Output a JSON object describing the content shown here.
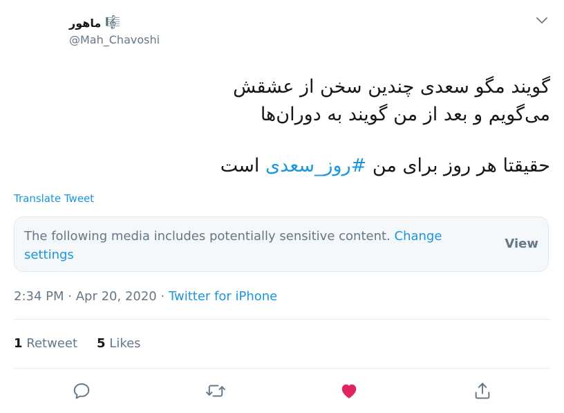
{
  "user": {
    "display_name": "ماهور",
    "name_emoji": "🎼",
    "handle": "@Mah_Chavoshi"
  },
  "tweet": {
    "line1": "گویند مگو سعدی چندین سخن از عشقش",
    "line2": "می‌گویم و بعد از من گویند به دوران‌ها",
    "line3_prefix": "حقیقتا هر روز برای من ",
    "hashtag": "#روز_سعدی",
    "line3_suffix": " است"
  },
  "translate_label": "Translate Tweet",
  "sensitive_notice": {
    "text": "The following media includes potentially sensitive content.",
    "link": "Change settings",
    "view_label": "View"
  },
  "meta": {
    "time": "2:34 PM",
    "separator": "·",
    "date": "Apr 20, 2020",
    "source": "Twitter for iPhone"
  },
  "stats": {
    "retweets_count": "1",
    "retweets_label": "Retweet",
    "likes_count": "5",
    "likes_label": "Likes"
  },
  "icons": {
    "caret": "chevron-down-icon",
    "reply": "reply-icon",
    "retweet": "retweet-icon",
    "like": "heart-icon",
    "share": "share-icon"
  },
  "colors": {
    "link": "#1b95e0",
    "secondary_text": "#657786",
    "like_active": "#e0245e"
  }
}
